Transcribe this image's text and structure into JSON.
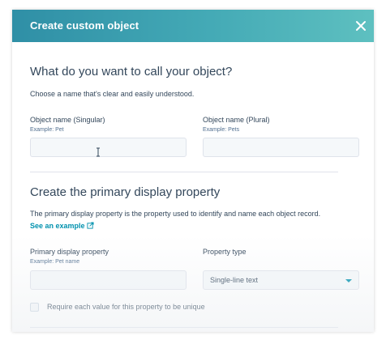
{
  "modal": {
    "title": "Create custom object",
    "close_icon": "close-icon"
  },
  "naming": {
    "heading": "What do you want to call your object?",
    "help": "Choose a name that's clear and easily understood.",
    "singular": {
      "label": "Object name (Singular)",
      "hint": "Example: Pet",
      "value": ""
    },
    "plural": {
      "label": "Object name (Plural)",
      "hint": "Example: Pets",
      "value": ""
    }
  },
  "display": {
    "heading": "Create the primary display property",
    "help": "The primary display property is the property used to identify and name each object record.",
    "link": "See an example",
    "link_icon": "external-link-icon",
    "primary": {
      "label": "Primary display property",
      "hint": "Example: Pet name",
      "value": ""
    },
    "type": {
      "label": "Property type",
      "selected": "Single-line text"
    },
    "unique_checkbox": {
      "label": "Require each value for this property to be unique",
      "checked": false
    }
  },
  "colors": {
    "accent": "#0091ae",
    "header_start": "#2f8fa6",
    "header_end": "#5ec0c0",
    "text": "#33475b"
  }
}
